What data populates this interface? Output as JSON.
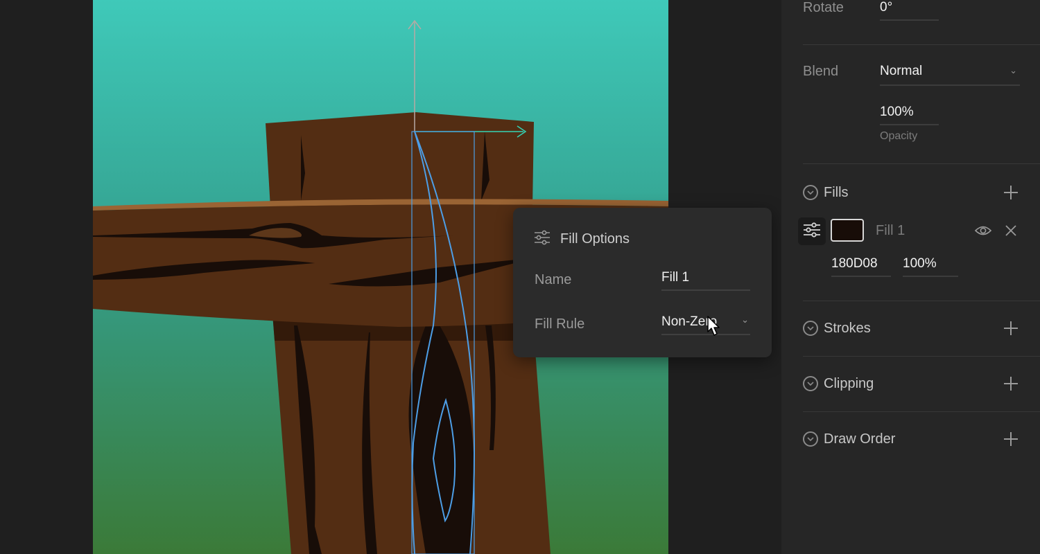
{
  "panel": {
    "rotate": {
      "label": "Rotate",
      "value": "0°"
    },
    "blend": {
      "label": "Blend",
      "value": "Normal"
    },
    "opacity": {
      "value": "100%",
      "label": "Opacity"
    },
    "sections": {
      "fills": "Fills",
      "strokes": "Strokes",
      "clipping": "Clipping",
      "draw_order": "Draw Order"
    },
    "fill_item": {
      "name": "Fill 1",
      "hex": "180D08",
      "opacity": "100%",
      "color": "#180D08"
    }
  },
  "fill_options_popup": {
    "title": "Fill Options",
    "name_label": "Name",
    "name_value": "Fill 1",
    "fill_rule_label": "Fill Rule",
    "fill_rule_value": "Non-Zero"
  },
  "colors": {
    "sky_top": "#3ec8b8",
    "sky_bottom": "#3b7a38",
    "wood": "#532d13",
    "wood_dark": "#180d08",
    "wood_highlight": "#9a6434",
    "selection": "#4d9ee6",
    "x_axis": "#34d3b4",
    "y_axis": "#b7a9a4"
  },
  "icons": {
    "fill_settings": "sliders-icon",
    "visibility": "eye-icon",
    "remove": "close-icon",
    "section_toggle": "chevron-down-circle-icon",
    "add": "plus-icon",
    "cursor": "pointer-cursor-icon"
  }
}
